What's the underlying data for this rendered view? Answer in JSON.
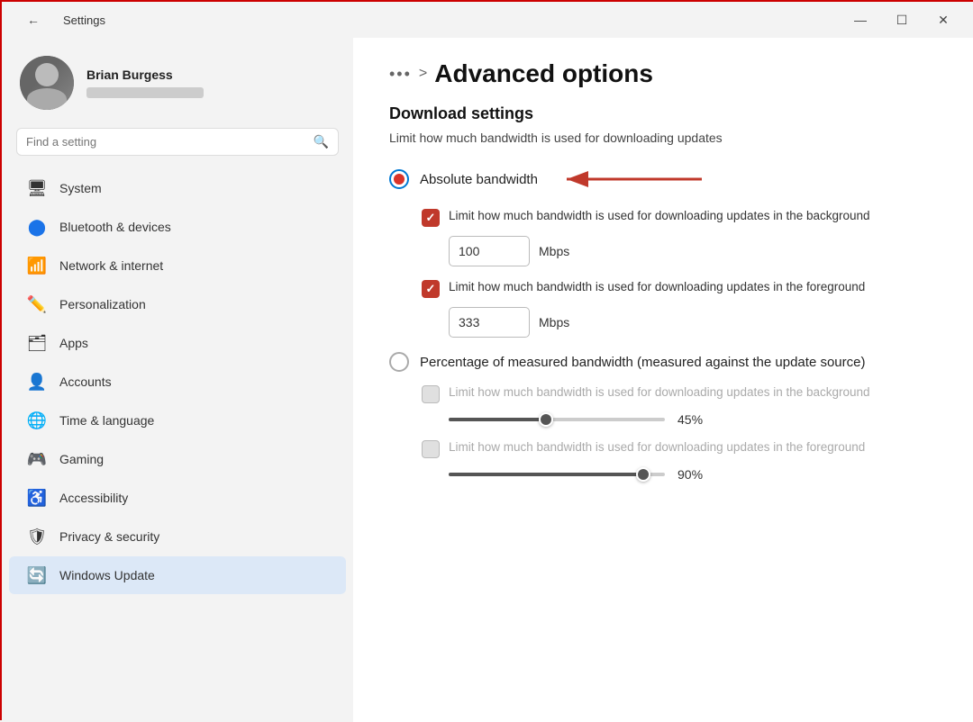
{
  "window": {
    "title": "Settings"
  },
  "titlebar": {
    "back_label": "←",
    "title": "Settings",
    "minimize_label": "—",
    "maximize_label": "☐",
    "close_label": "✕"
  },
  "user": {
    "name": "Brian Burgess"
  },
  "search": {
    "placeholder": "Find a setting"
  },
  "nav": {
    "items": [
      {
        "label": "System",
        "icon": "🖥",
        "id": "system"
      },
      {
        "label": "Bluetooth & devices",
        "icon": "🔵",
        "id": "bluetooth"
      },
      {
        "label": "Network & internet",
        "icon": "📶",
        "id": "network"
      },
      {
        "label": "Personalization",
        "icon": "✏️",
        "id": "personalization"
      },
      {
        "label": "Apps",
        "icon": "🗂",
        "id": "apps"
      },
      {
        "label": "Accounts",
        "icon": "👤",
        "id": "accounts"
      },
      {
        "label": "Time & language",
        "icon": "🌐",
        "id": "time"
      },
      {
        "label": "Gaming",
        "icon": "🎮",
        "id": "gaming"
      },
      {
        "label": "Accessibility",
        "icon": "♿",
        "id": "accessibility"
      },
      {
        "label": "Privacy & security",
        "icon": "🛡",
        "id": "privacy"
      },
      {
        "label": "Windows Update",
        "icon": "🔄",
        "id": "update",
        "active": true
      }
    ]
  },
  "main": {
    "breadcrumb_dots": "•••",
    "breadcrumb_sep": ">",
    "page_title": "Advanced options",
    "section_title": "Download settings",
    "section_desc": "Limit how much bandwidth is used for downloading updates",
    "radio_absolute_label": "Absolute bandwidth",
    "radio_absolute_selected": true,
    "checkbox1_label": "Limit how much bandwidth is used for downloading updates in the background",
    "checkbox1_checked": true,
    "input1_value": "100",
    "input1_unit": "Mbps",
    "checkbox2_label": "Limit how much bandwidth is used for downloading updates in the foreground",
    "checkbox2_checked": true,
    "input2_value": "333",
    "input2_unit": "Mbps",
    "radio_percentage_label": "Percentage of measured bandwidth (measured against the update source)",
    "radio_percentage_selected": false,
    "checkbox3_label": "Limit how much bandwidth is used for downloading updates in the background",
    "checkbox3_checked": false,
    "slider1_pct": "45%",
    "slider1_fill_pct": 45,
    "checkbox4_label": "Limit how much bandwidth is used for downloading updates in the foreground",
    "checkbox4_checked": false,
    "slider2_pct": "90%",
    "slider2_fill_pct": 90
  }
}
